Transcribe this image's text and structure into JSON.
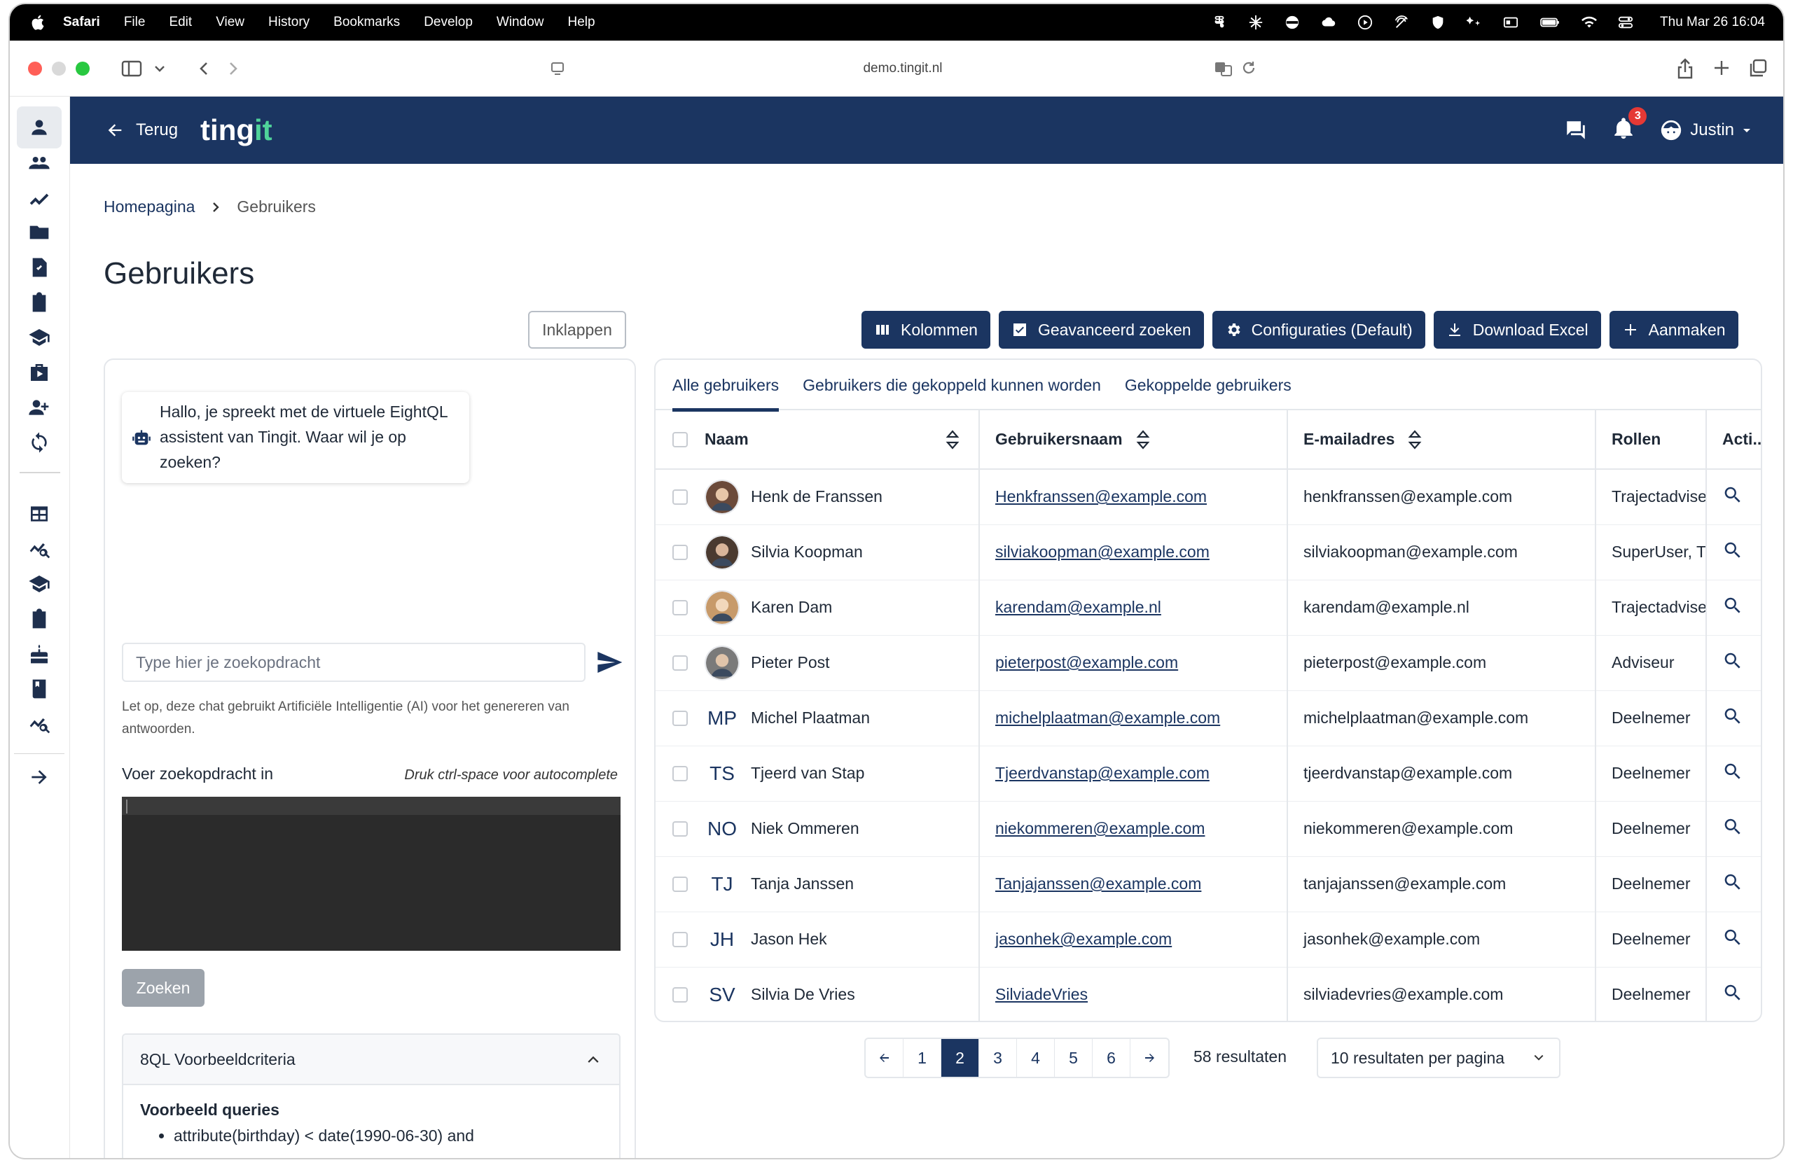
{
  "menubar": {
    "app": "Safari",
    "items": [
      "File",
      "Edit",
      "View",
      "History",
      "Bookmarks",
      "Develop",
      "Window",
      "Help"
    ],
    "clock": "Thu Mar 26  16:04"
  },
  "browser": {
    "url": "demo.tingit.nl"
  },
  "header": {
    "back_label": "Terug",
    "logo_main": "ting",
    "logo_accent": "it",
    "notification_count": "3",
    "user_name": "Justin",
    "bg_color": "#1b3561",
    "accent_color": "#4fd39a"
  },
  "breadcrumb": {
    "home": "Homepagina",
    "current": "Gebruikers"
  },
  "page": {
    "title": "Gebruikers",
    "collapse_label": "Inklappen"
  },
  "chat": {
    "greeting": "Hallo, je spreekt met de virtuele EightQL assistent van Tingit. Waar wil je op zoeken?",
    "input_placeholder": "Type hier je zoekopdracht",
    "disclaimer": "Let op, deze chat gebruikt Artificiële Intelligentie (AI) voor het genereren van antwoorden.",
    "query_label": "Voer zoekopdracht in",
    "query_hint": "Druk ctrl-space voor autocomplete",
    "search_button": "Zoeken",
    "accordion_title": "8QL Voorbeeldcriteria",
    "examples_title": "Voorbeeld queries",
    "example_1": "attribute(birthday) < date(1990-06-30) and"
  },
  "actions": {
    "columns": "Kolommen",
    "advanced": "Geavanceerd zoeken",
    "configs": "Configuraties (Default)",
    "excel": "Download Excel",
    "create": "Aanmaken"
  },
  "tabs": [
    "Alle gebruikers",
    "Gebruikers die gekoppeld kunnen worden",
    "Gekoppelde gebruikers"
  ],
  "table": {
    "headers": {
      "name": "Naam",
      "username": "Gebruikersnaam",
      "email": "E-mailadres",
      "roles": "Rollen",
      "actions": "Acti..."
    },
    "rows": [
      {
        "avatar": "photo",
        "initials": "",
        "name": "Henk de Franssen",
        "username": "Henkfranssen@example.com",
        "email": "henkfranssen@example.com",
        "role": "Trajectadviseur"
      },
      {
        "avatar": "photo",
        "initials": "",
        "name": "Silvia Koopman",
        "username": "silviakoopman@example.com",
        "email": "silviakoopman@example.com",
        "role": "SuperUser, Trajectadviseur"
      },
      {
        "avatar": "photo",
        "initials": "",
        "name": "Karen Dam",
        "username": "karendam@example.nl",
        "email": "karendam@example.nl",
        "role": "Trajectadviseur"
      },
      {
        "avatar": "photo",
        "initials": "",
        "name": "Pieter Post",
        "username": "pieterpost@example.com",
        "email": "pieterpost@example.com",
        "role": "Adviseur"
      },
      {
        "avatar": "initials",
        "initials": "MP",
        "name": "Michel Plaatman",
        "username": "michelplaatman@example.com",
        "email": "michelplaatman@example.com",
        "role": "Deelnemer"
      },
      {
        "avatar": "initials",
        "initials": "TS",
        "name": "Tjeerd van Stap",
        "username": "Tjeerdvanstap@example.com",
        "email": "tjeerdvanstap@example.com",
        "role": "Deelnemer"
      },
      {
        "avatar": "initials",
        "initials": "NO",
        "name": "Niek Ommeren",
        "username": "niekommeren@example.com",
        "email": "niekommeren@example.com",
        "role": "Deelnemer"
      },
      {
        "avatar": "initials",
        "initials": "TJ",
        "name": "Tanja Janssen",
        "username": "Tanjajanssen@example.com",
        "email": "tanjajanssen@example.com",
        "role": "Deelnemer"
      },
      {
        "avatar": "initials",
        "initials": "JH",
        "name": "Jason Hek",
        "username": "jasonhek@example.com",
        "email": "jasonhek@example.com",
        "role": "Deelnemer"
      },
      {
        "avatar": "initials",
        "initials": "SV",
        "name": "Silvia De Vries",
        "username": "SilviadeVries",
        "email": "silviadevries@example.com",
        "role": "Deelnemer"
      }
    ]
  },
  "pagination": {
    "pages": [
      "1",
      "2",
      "3",
      "4",
      "5",
      "6"
    ],
    "current": "2",
    "results": "58 resultaten",
    "per_page": "10 resultaten per pagina"
  }
}
